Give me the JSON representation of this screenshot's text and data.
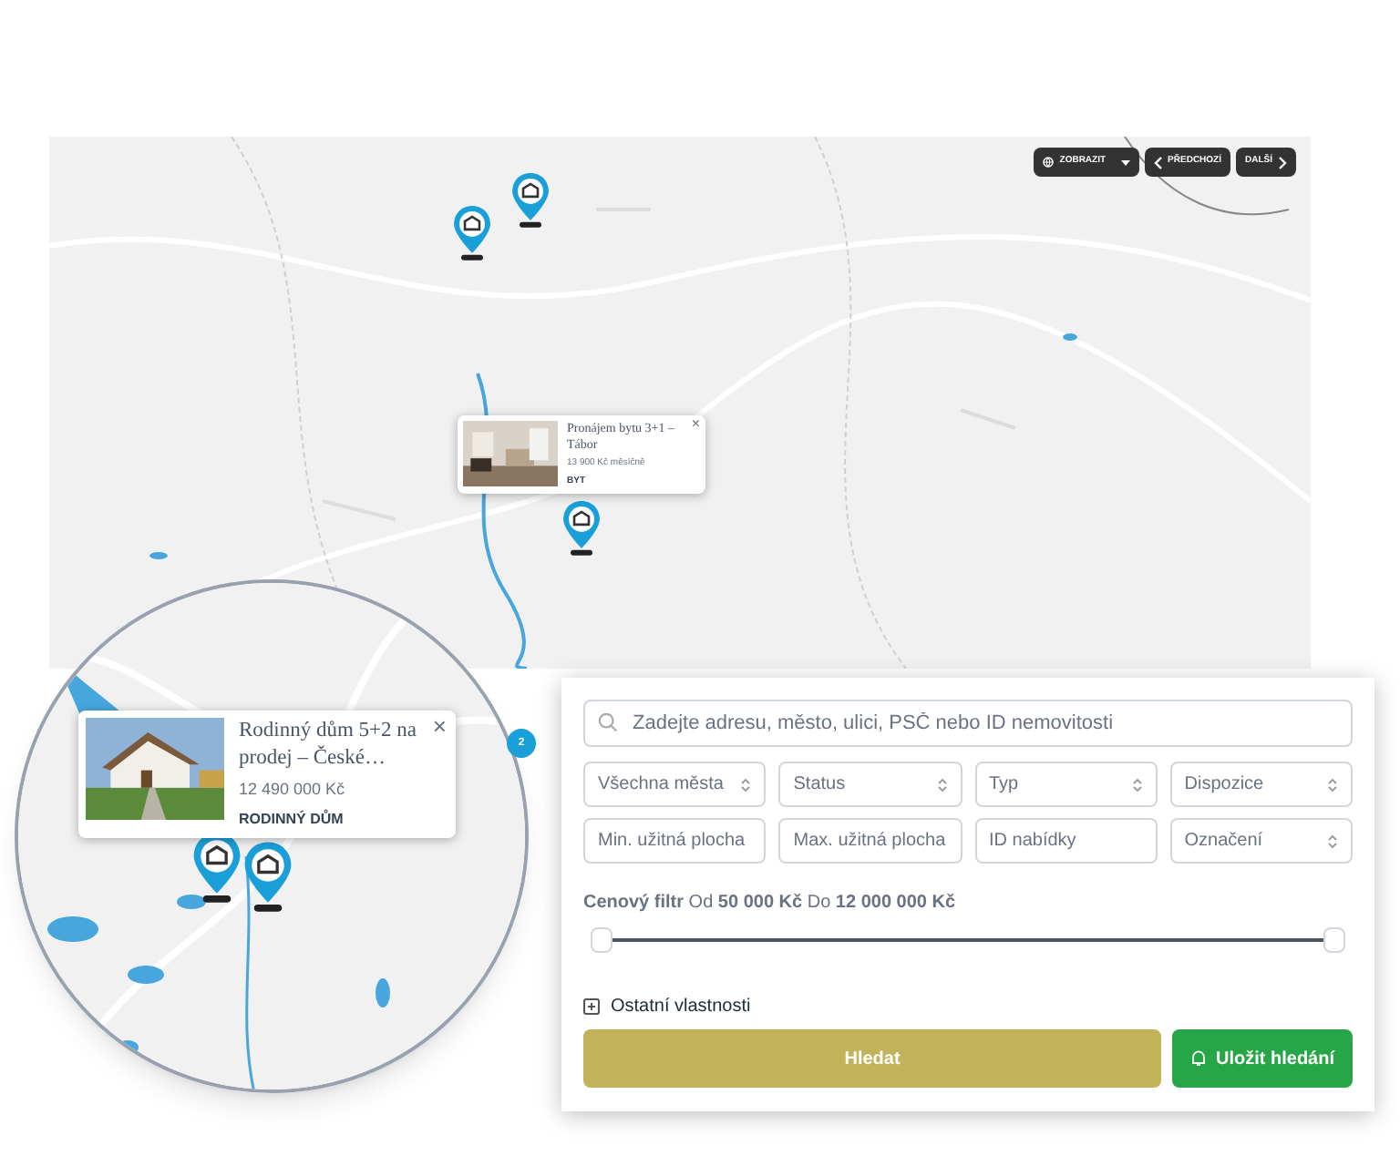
{
  "map": {
    "controls": [
      {
        "kind": "display",
        "label": "ZOBRAZIT"
      },
      {
        "kind": "prev",
        "label": "PŘEDCHOZÍ"
      },
      {
        "kind": "next",
        "label": "DALŠÍ"
      }
    ],
    "popup": {
      "title": "Pronájem bytu 3+1 – Tábor",
      "price": "13 900 Kč měsíčně",
      "type": "BYT",
      "close": "×"
    },
    "cluster": {
      "count": "2"
    }
  },
  "magnifier": {
    "popup": {
      "title": "Rodinný dům 5+2 na prodej – České…",
      "price": "12 490 000 Kč",
      "type": "RODINNÝ DŮM",
      "close": "×"
    }
  },
  "search": {
    "placeholder": "Zadejte adresu, město, ulici, PSČ nebo ID nemovitosti",
    "filters": [
      {
        "kind": "select",
        "placeholder": "Všechna města"
      },
      {
        "kind": "select",
        "placeholder": "Status"
      },
      {
        "kind": "select",
        "placeholder": "Typ"
      },
      {
        "kind": "select",
        "placeholder": "Dispozice"
      },
      {
        "kind": "input",
        "placeholder": "Min. užitná plocha"
      },
      {
        "kind": "input",
        "placeholder": "Max. užitná plocha"
      },
      {
        "kind": "input",
        "placeholder": "ID nabídky"
      },
      {
        "kind": "select",
        "placeholder": "Označení"
      }
    ],
    "price_filter": "**Cenový filtr** Od **50 000 Kč** Do **12 000 000 Kč**",
    "price_range": {
      "level": 1
    },
    "more": {
      "label": "Ostatní vlastnosti",
      "expanded": false
    },
    "buttons": [
      {
        "kind": "primary",
        "label": "Hledat"
      },
      {
        "kind": "save",
        "label": "Uložit hledání"
      }
    ]
  }
}
